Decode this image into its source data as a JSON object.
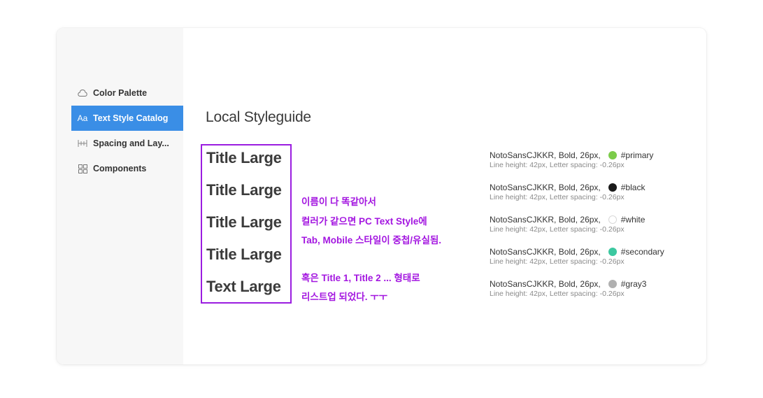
{
  "sidebar": {
    "items": [
      {
        "icon": "cloud-icon",
        "label": "Color Palette",
        "active": false
      },
      {
        "icon": "aa-text-icon",
        "label": "Text Style Catalog",
        "active": true
      },
      {
        "icon": "spacing-icon",
        "label": "Spacing and Lay...",
        "active": false
      },
      {
        "icon": "grid-icon",
        "label": "Components",
        "active": false
      }
    ]
  },
  "main": {
    "title": "Local Styleguide",
    "samples": [
      "Title Large",
      "Title Large",
      "Title Large",
      "Title Large",
      "Text Large"
    ],
    "annotation_lines": [
      "이름이 다 똑같아서",
      "컬러가 같으면 PC Text Style에",
      "Tab, Mobile 스타일이 중첩/유실됨.",
      "혹은 Title 1, Title 2 ... 형태로",
      "리스트업 되었다. ㅜㅜ"
    ],
    "annotation_color": "#a316e0",
    "specs": [
      {
        "font": "NotoSansCJKKR, Bold, 26px,",
        "color_name": "#primary",
        "swatch": "#7ccc4a",
        "meta": "Line height: 42px, Letter spacing: -0.26px"
      },
      {
        "font": "NotoSansCJKKR, Bold, 26px,",
        "color_name": "#black",
        "swatch": "#1a1a1a",
        "meta": "Line height: 42px, Letter spacing: -0.26px"
      },
      {
        "font": "NotoSansCJKKR, Bold, 26px,",
        "color_name": "#white",
        "swatch": "#ffffff",
        "meta": "Line height: 42px, Letter spacing: -0.26px"
      },
      {
        "font": "NotoSansCJKKR, Bold, 26px,",
        "color_name": "#secondary",
        "swatch": "#3cc8a0",
        "meta": "Line height: 42px, Letter spacing: -0.26px"
      },
      {
        "font": "NotoSansCJKKR, Bold, 26px,",
        "color_name": "#gray3",
        "swatch": "#b0b0b0",
        "meta": "Line height: 42px, Letter spacing: -0.26px"
      }
    ]
  }
}
